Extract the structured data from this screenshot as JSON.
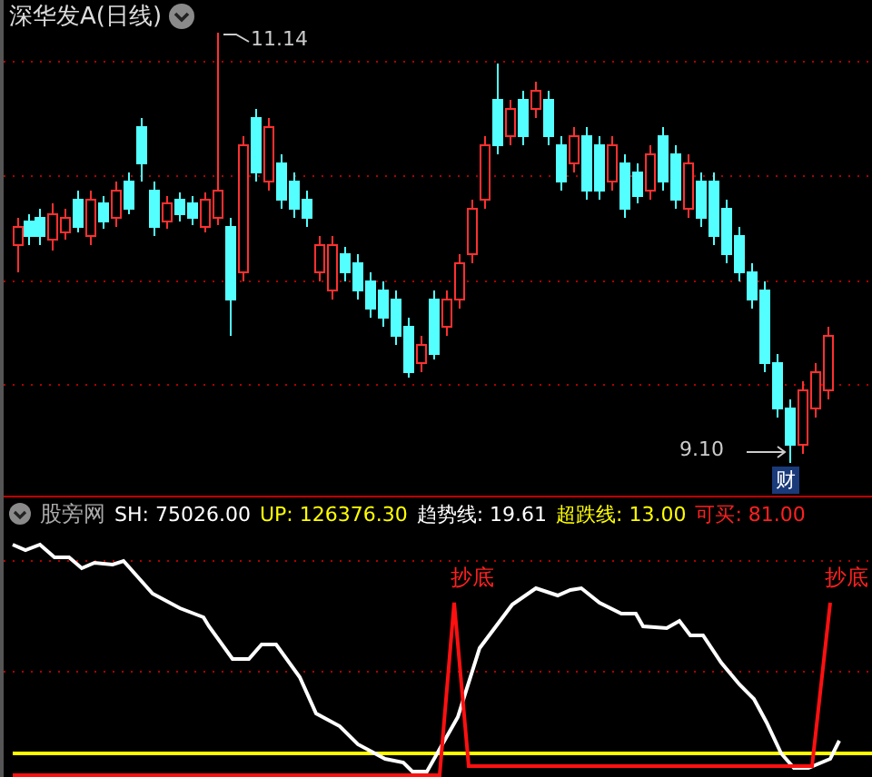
{
  "main_panel": {
    "title": "深华发A(日线)",
    "high_marker": "11.14",
    "low_marker": "9.10",
    "badge": "财"
  },
  "indicator_panel": {
    "name": "股旁网",
    "readings": [
      {
        "label": "SH: 75026.00",
        "color": "#ffffff"
      },
      {
        "label": "UP: 126376.30",
        "color": "#ffff00"
      },
      {
        "label": "趋势线: 19.61",
        "color": "#ffffff"
      },
      {
        "label": "超跌线: 13.00",
        "color": "#ffff00"
      },
      {
        "label": "可买: 81.00",
        "color": "#ff2020"
      }
    ],
    "signals": [
      "抄底",
      "抄底"
    ]
  }
}
